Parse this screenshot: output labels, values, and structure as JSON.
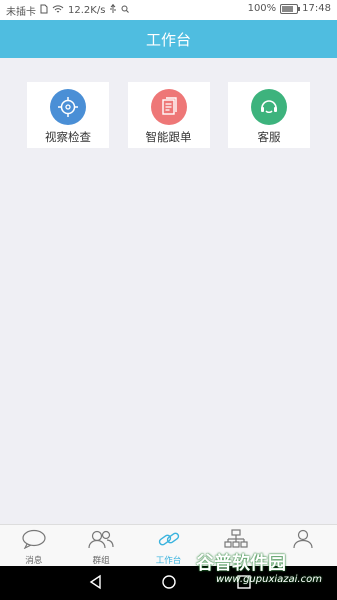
{
  "status": {
    "carrier": "未插卡",
    "speed": "12.2K/s",
    "battery": "100%",
    "time": "17:48"
  },
  "header": {
    "title": "工作台"
  },
  "cards": [
    {
      "label": "视察检查",
      "color": "#4a8fd6",
      "icon": "target-icon"
    },
    {
      "label": "智能跟单",
      "color": "#ee7777",
      "icon": "document-icon"
    },
    {
      "label": "客服",
      "color": "#3db37d",
      "icon": "headset-icon"
    }
  ],
  "tabs": [
    {
      "label": "消息",
      "icon": "chat-bubble-icon"
    },
    {
      "label": "群组",
      "icon": "group-icon"
    },
    {
      "label": "工作台",
      "icon": "link-icon",
      "active": true
    },
    {
      "label": "",
      "icon": "org-chart-icon"
    },
    {
      "label": "",
      "icon": "person-icon"
    }
  ],
  "watermark": {
    "title": "谷普软件园",
    "url": "www.gupuxiazai.com"
  }
}
